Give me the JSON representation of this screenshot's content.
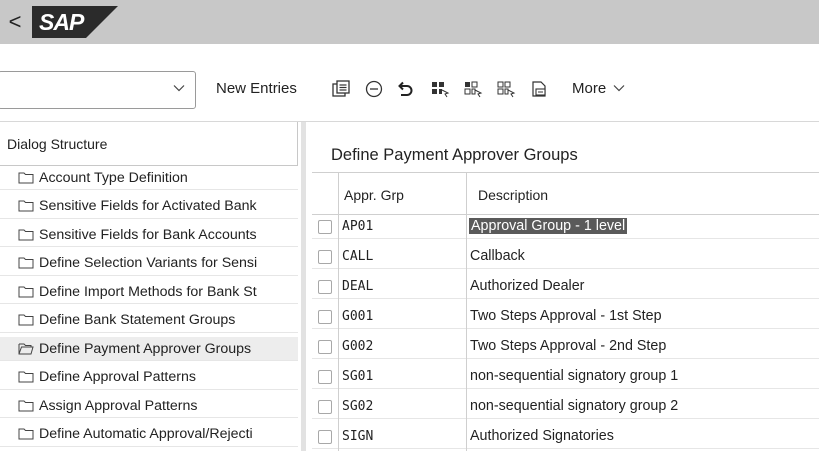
{
  "header": {
    "back_glyph": "<",
    "logo_text": "SAP"
  },
  "toolbar": {
    "variant_value": "",
    "new_entries_label": "New Entries",
    "more_label": "More",
    "icons": [
      "copy-as-icon",
      "delete-row-icon",
      "undo-icon",
      "select-all-icon",
      "select-block-icon",
      "deselect-all-icon",
      "print-icon"
    ]
  },
  "dialog_structure": {
    "title": "Dialog Structure",
    "items": [
      {
        "label": "Account Type Definition",
        "selected": false
      },
      {
        "label": "Sensitive Fields for Activated Bank",
        "selected": false
      },
      {
        "label": "Sensitive Fields for Bank Accounts",
        "selected": false
      },
      {
        "label": "Define Selection Variants for Sensi",
        "selected": false
      },
      {
        "label": "Define Import Methods for Bank St",
        "selected": false
      },
      {
        "label": "Define Bank Statement Groups",
        "selected": false
      },
      {
        "label": "Define Payment Approver Groups",
        "selected": true
      },
      {
        "label": "Define Approval Patterns",
        "selected": false
      },
      {
        "label": "Assign Approval Patterns",
        "selected": false
      },
      {
        "label": "Define Automatic Approval/Rejecti",
        "selected": false
      }
    ]
  },
  "main": {
    "title": "Define Payment Approver Groups",
    "columns": {
      "group": "Appr. Grp",
      "description": "Description"
    },
    "rows": [
      {
        "group": "AP01",
        "description": "Approval Group - 1 level",
        "highlighted": true
      },
      {
        "group": "CALL",
        "description": "Callback"
      },
      {
        "group": "DEAL",
        "description": "Authorized Dealer"
      },
      {
        "group": "G001",
        "description": "Two Steps Approval - 1st Step"
      },
      {
        "group": "G002",
        "description": "Two Steps Approval - 2nd Step"
      },
      {
        "group": "SG01",
        "description": "non-sequential signatory group 1"
      },
      {
        "group": "SG02",
        "description": "non-sequential signatory group 2"
      },
      {
        "group": "SIGN",
        "description": "Authorized Signatories"
      }
    ]
  },
  "colors": {
    "header_bg": "#c8c8c8",
    "logo_blue": "#1a1a1a",
    "highlight_bg": "#5a5a5a",
    "selected_row_bg": "#ededed"
  }
}
